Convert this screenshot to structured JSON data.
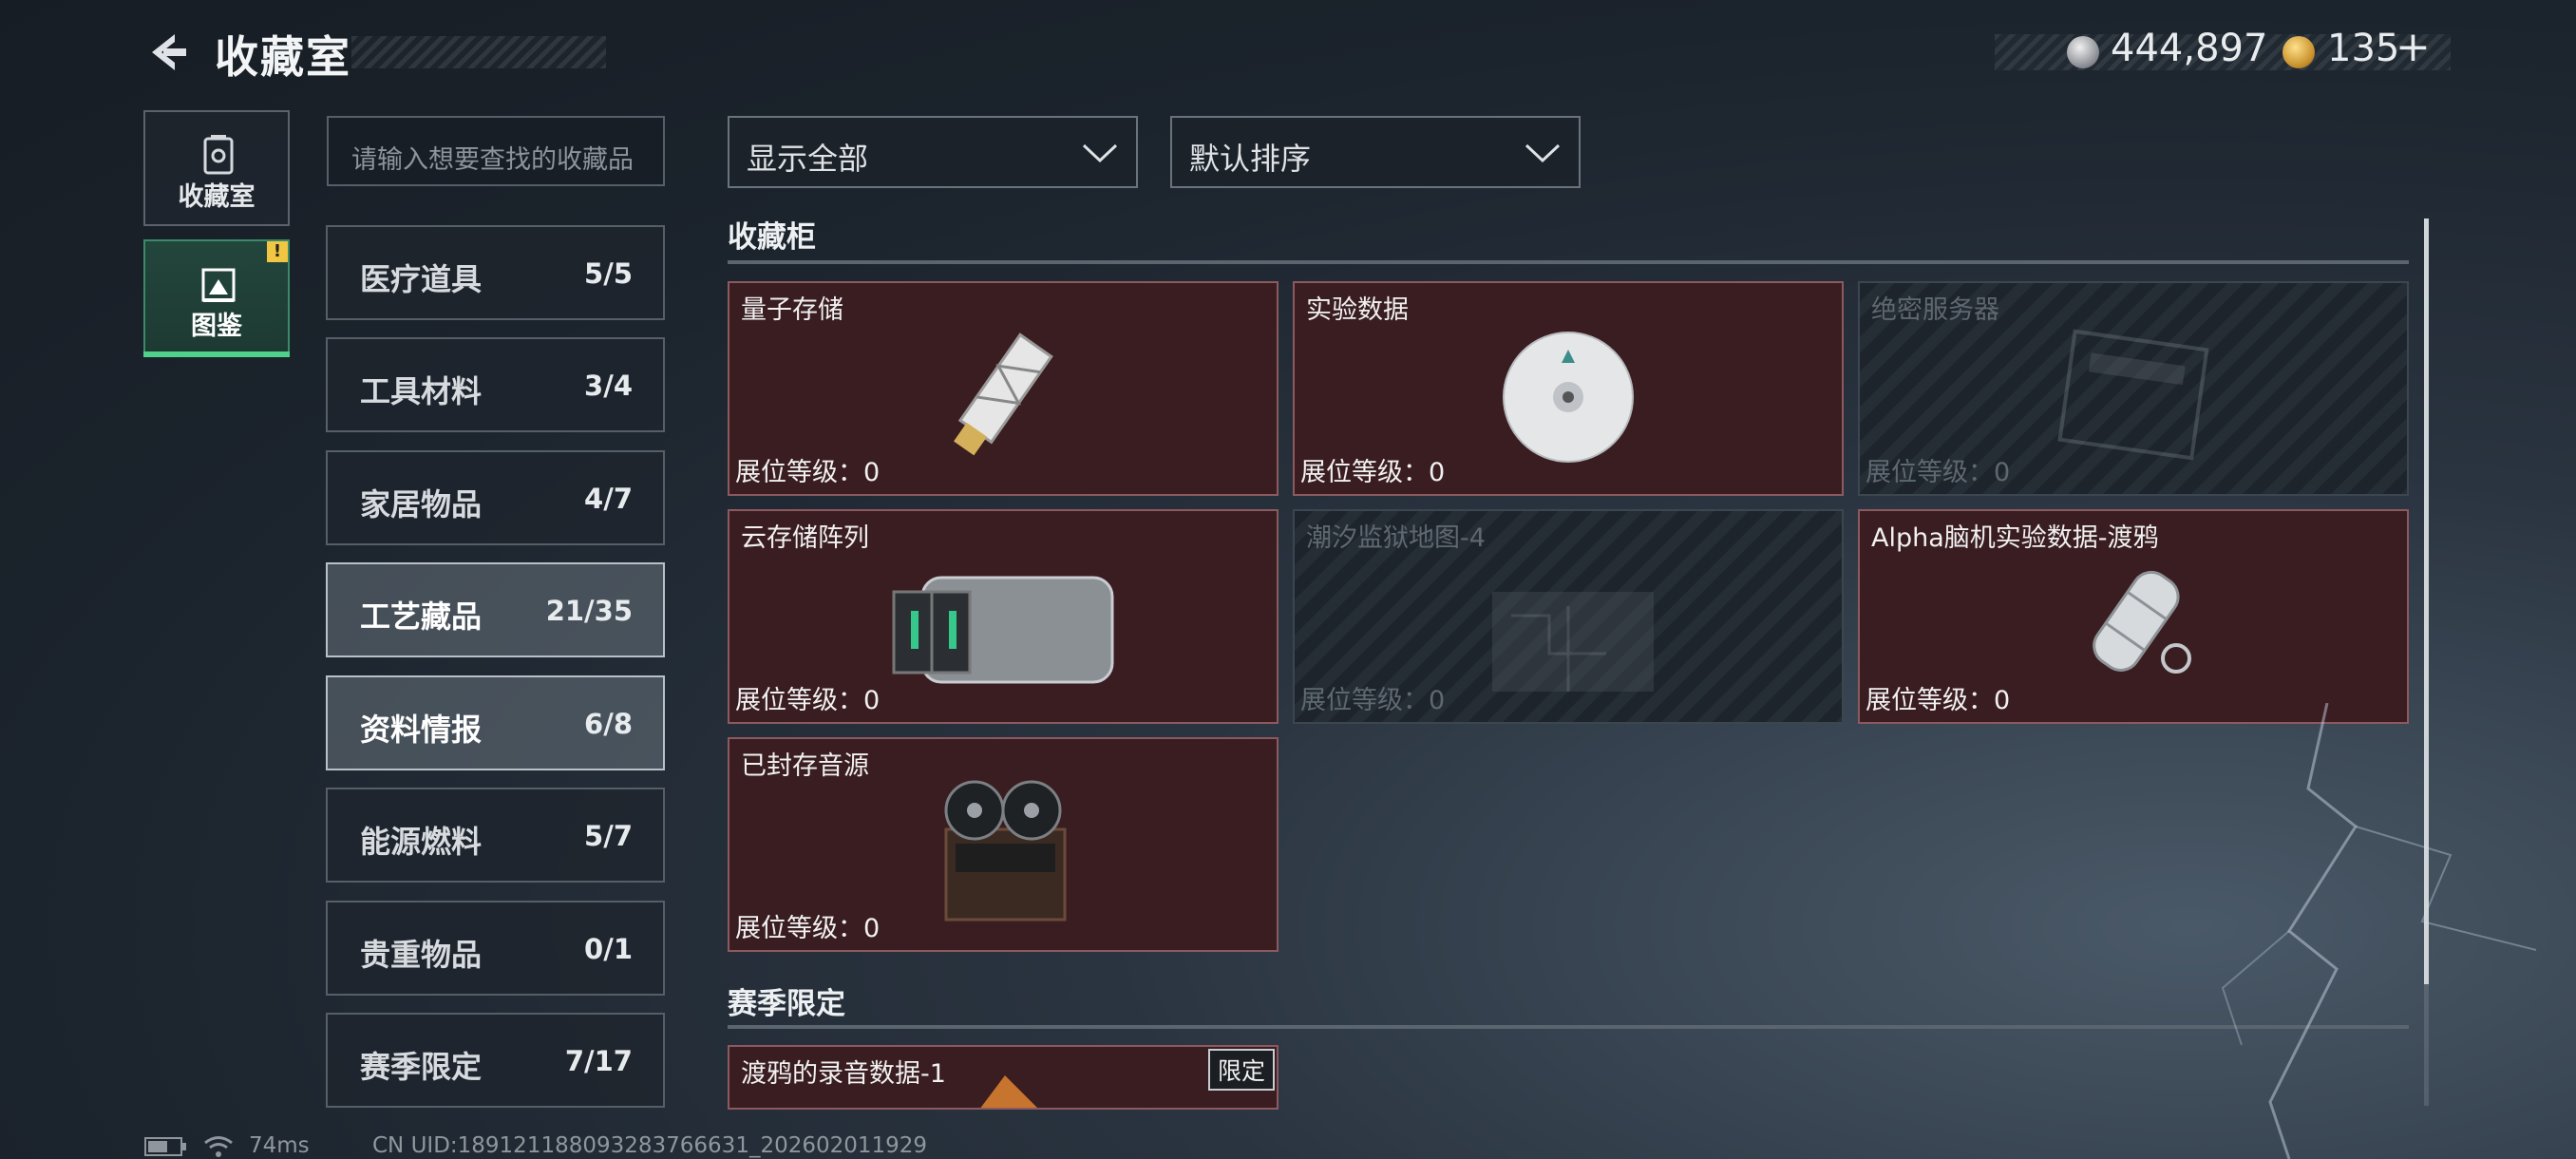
{
  "header": {
    "title": "收藏室",
    "currency_silver": "444,897",
    "currency_gold": "135",
    "currency_add": "+"
  },
  "nav": [
    {
      "label": "收藏室",
      "icon": "trash-bin-icon"
    },
    {
      "label": "图鉴",
      "icon": "album-icon",
      "badge": "!"
    }
  ],
  "search": {
    "placeholder": "请输入想要查找的收藏品"
  },
  "categories": [
    {
      "name": "医疗道具",
      "count": "5/5"
    },
    {
      "name": "工具材料",
      "count": "3/4"
    },
    {
      "name": "家居物品",
      "count": "4/7"
    },
    {
      "name": "工艺藏品",
      "count": "21/35"
    },
    {
      "name": "资料情报",
      "count": "6/8"
    },
    {
      "name": "能源燃料",
      "count": "5/7"
    },
    {
      "name": "贵重物品",
      "count": "0/1"
    },
    {
      "name": "赛季限定",
      "count": "7/17"
    }
  ],
  "filters": {
    "show": "显示全部",
    "sort": "默认排序"
  },
  "sections": [
    {
      "title": "收藏柜",
      "items": [
        {
          "name": "量子存储",
          "level": "展位等级：0",
          "locked": false
        },
        {
          "name": "实验数据",
          "level": "展位等级：0",
          "locked": false
        },
        {
          "name": "绝密服务器",
          "level": "展位等级：0",
          "locked": true
        },
        {
          "name": "云存储阵列",
          "level": "展位等级：0",
          "locked": false
        },
        {
          "name": "潮汐监狱地图-4",
          "level": "展位等级：0",
          "locked": true
        },
        {
          "name": "Alpha脑机实验数据-渡鸦",
          "level": "展位等级：0",
          "locked": false
        },
        {
          "name": "已封存音源",
          "level": "展位等级：0",
          "locked": false
        }
      ]
    },
    {
      "title": "赛季限定",
      "items": [
        {
          "name": "渡鸦的录音数据-1",
          "tag": "限定"
        }
      ]
    }
  ],
  "footer": {
    "ping": "74ms",
    "uid": "CN UID:18912118809328376663​1_202602011929"
  }
}
